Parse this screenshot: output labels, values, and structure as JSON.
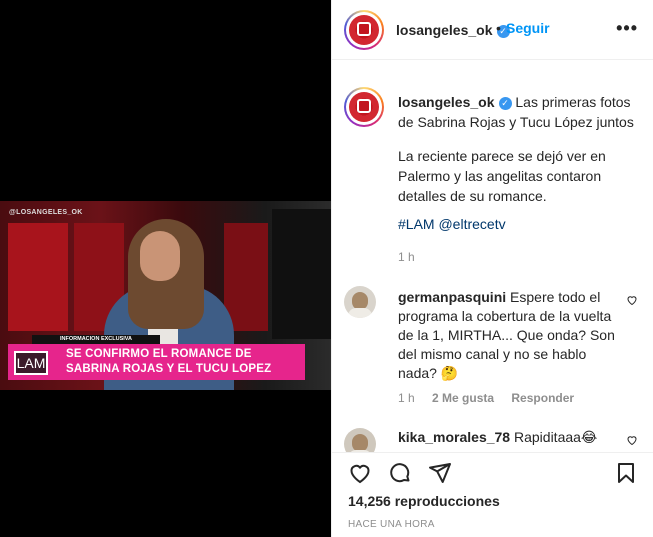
{
  "post": {
    "username": "losangeles_ok",
    "follow_label": "Seguir",
    "header_separator": "•",
    "more_label": "•••",
    "verified_glyph": "✓"
  },
  "video": {
    "watermark": "@LOSANGELES_OK",
    "info_tag": "INFORMACION EXCLUSIVA",
    "logo_text": "LAM",
    "headline": "SE CONFIRMO EL ROMANCE DE SABRINA ROJAS Y EL TUCU LOPEZ"
  },
  "caption": {
    "username": "losangeles_ok",
    "line1": "Las primeras fotos de Sabrina Rojas y Tucu López juntos",
    "paragraph2": "La reciente parece se dejó ver en Palermo y las angelitas contaron detalles de su romance.",
    "tags": "#LAM @eltrecetv",
    "time": "1 h"
  },
  "comments": [
    {
      "username": "germanpasquini",
      "text": "Espere todo el programa la cobertura de la vuelta de la 1, MIRTHA... Que onda? Son del mismo canal y no se hablo nada? 🤔",
      "time": "1 h",
      "likes": "2 Me gusta",
      "reply": "Responder"
    },
    {
      "username": "kika_morales_78",
      "text": "Rapiditaaa😂"
    }
  ],
  "footer": {
    "views": "14,256 reproducciones",
    "ago": "HACE UNA HORA"
  },
  "icons": {
    "like": "heart-icon",
    "comment": "comment-icon",
    "share": "share-icon",
    "save": "bookmark-icon"
  },
  "colors": {
    "link": "#0095f6",
    "tag": "#00376b",
    "muted": "#8e8e8e",
    "lower_third": "#e6258c"
  }
}
